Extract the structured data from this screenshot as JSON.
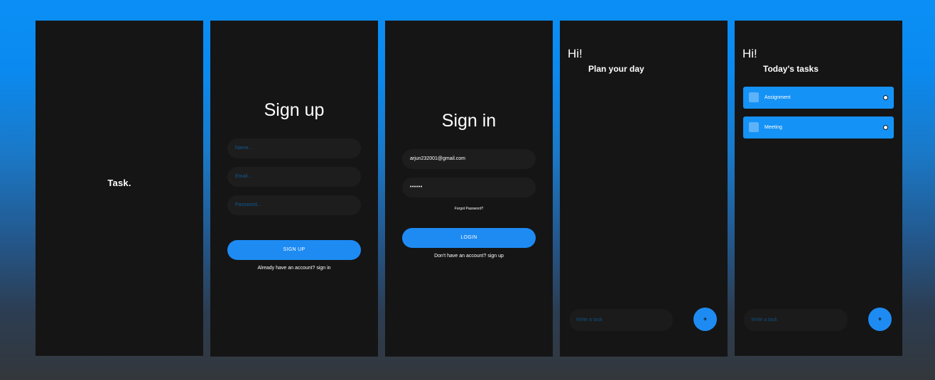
{
  "splash": {
    "logo": "Task."
  },
  "signup": {
    "title": "Sign up",
    "name_placeholder": "Name...",
    "email_placeholder": "Email...",
    "password_placeholder": "Password...",
    "button_label": "SIGN UP",
    "signin_link": "Already have an account? sign in"
  },
  "signin": {
    "title": "Sign in",
    "email_value": "arjun232001@gmail.com",
    "password_value": "••••••",
    "forgot_link": "Forgot Password?",
    "button_label": "LOGIN",
    "signup_link": "Don't have an account? sign up"
  },
  "home_empty": {
    "greeting": "Hi!",
    "subtitle": "Plan your day",
    "task_placeholder": "Write a task",
    "add_label": "+"
  },
  "home_tasks": {
    "greeting": "Hi!",
    "subtitle": "Today's tasks",
    "tasks": [
      {
        "label": "Assignment"
      },
      {
        "label": "Meeting"
      }
    ],
    "task_placeholder": "Write a task",
    "add_label": "+"
  },
  "colors": {
    "accent": "#1e8bf3",
    "screen_bg": "#151515",
    "task_card": "#1592f6"
  }
}
